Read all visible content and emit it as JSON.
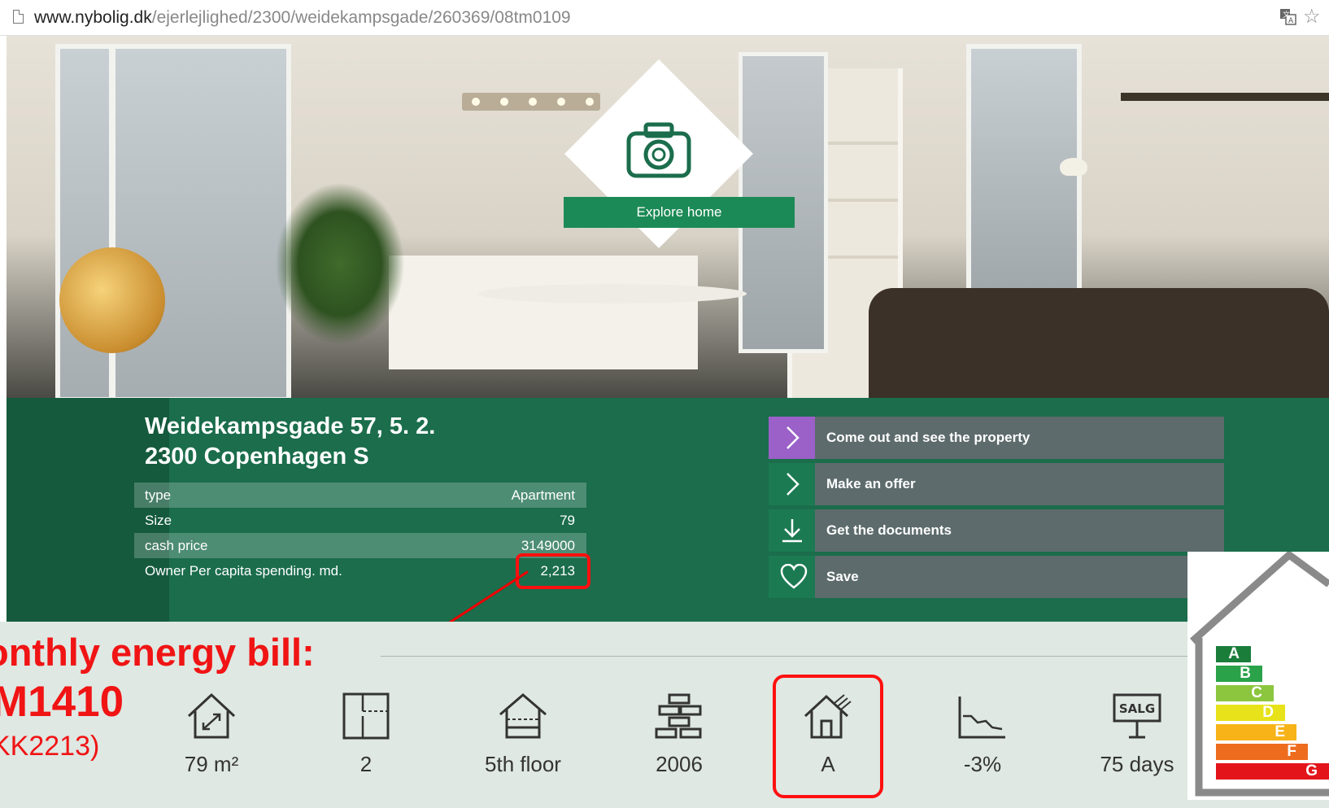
{
  "browser": {
    "url_host": "www.nybolig.dk",
    "url_path": "/ejerlejlighed/2300/weidekampsgade/260369/08tm0109"
  },
  "hero": {
    "explore_label": "Explore home"
  },
  "property": {
    "address_line1": "Weidekampsgade 57, 5. 2.",
    "address_line2": "2300 Copenhagen S",
    "facts": [
      {
        "label": "type",
        "value": "Apartment"
      },
      {
        "label": "Size",
        "value": "79"
      },
      {
        "label": "cash price",
        "value": "3149000"
      },
      {
        "label": "Owner Per capita spending. md.",
        "value": "2,213"
      }
    ]
  },
  "actions": [
    {
      "label": "Come out and see the property",
      "icon": "chevron-right-icon"
    },
    {
      "label": "Make an offer",
      "icon": "chevron-right-icon"
    },
    {
      "label": "Get the documents",
      "icon": "download-icon"
    },
    {
      "label": "Save",
      "icon": "heart-icon"
    }
  ],
  "stats": [
    {
      "value": "79 m²",
      "icon": "house-size-icon"
    },
    {
      "value": "2",
      "icon": "floorplan-rooms-icon"
    },
    {
      "value": "5th floor",
      "icon": "house-floor-icon"
    },
    {
      "value": "2006",
      "icon": "bricks-year-icon"
    },
    {
      "value": "A",
      "icon": "house-energy-icon"
    },
    {
      "value": "-3%",
      "icon": "price-drop-graph-icon"
    },
    {
      "value": "75 days",
      "icon": "for-sale-sign-icon"
    }
  ],
  "annotation": {
    "line1": "onthly energy bill:",
    "line2": "M1410",
    "line3": "KK2213)",
    "color": "#f01414"
  },
  "energy_label": {
    "classes": [
      "A",
      "B",
      "C",
      "D",
      "E",
      "F",
      "G"
    ],
    "colors": [
      "#1a7d3a",
      "#2aa24a",
      "#8cc63f",
      "#e7e21a",
      "#f7b318",
      "#ee6c1e",
      "#e3151b"
    ]
  },
  "colors": {
    "brand_green": "#1c8a56",
    "band_green": "#1b6d4c",
    "accent_purple": "#9b61c8",
    "highlight_red": "#ff1010"
  }
}
